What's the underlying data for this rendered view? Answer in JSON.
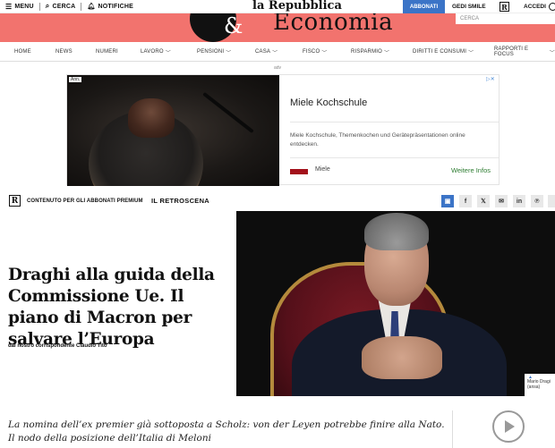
{
  "topbar": {
    "menu_label": "MENU",
    "search_label": "CERCA",
    "notifications_label": "NOTIFICHE",
    "logo": "la Repubblica",
    "subscribe_label": "ABBONATI",
    "gedi_label": "GEDI SMILE",
    "r_mark": "R",
    "login_label": "ACCEDI"
  },
  "banner": {
    "amp": "&",
    "title": "Economia",
    "search_placeholder": "CERCA"
  },
  "nav": {
    "items": [
      {
        "label": "HOME",
        "dropdown": false
      },
      {
        "label": "NEWS",
        "dropdown": false
      },
      {
        "label": "NUMERI",
        "dropdown": false
      },
      {
        "label": "LAVORO",
        "dropdown": true
      },
      {
        "label": "PENSIONI",
        "dropdown": true
      },
      {
        "label": "CASA",
        "dropdown": true
      },
      {
        "label": "FISCO",
        "dropdown": true
      },
      {
        "label": "RISPARMIO",
        "dropdown": true
      },
      {
        "label": "DIRITTI E CONSUMI",
        "dropdown": true
      },
      {
        "label": "RAPPORTI E FOCUS",
        "dropdown": true
      }
    ]
  },
  "ad": {
    "adv_label": "adv",
    "badge": "Ann.",
    "title": "Miele Kochschule",
    "description": "Miele Kochschule, Themenkochen und Gerätepräsentationen online entdecken.",
    "brand": "Miele",
    "cta": "Weitere Infos"
  },
  "section": {
    "r_mark": "R",
    "premium_label": "CONTENUTO PER GLI ABBONATI PREMIUM",
    "category": "IL RETROSCENA"
  },
  "share": {
    "icons": [
      "comment-icon",
      "facebook-icon",
      "x-icon",
      "mail-icon",
      "linkedin-icon",
      "pinterest-icon",
      "whatsapp-icon"
    ],
    "glyphs": [
      "▣",
      "f",
      "𝕏",
      "✉",
      "in",
      "℗",
      "◔"
    ]
  },
  "article": {
    "headline": "Draghi alla guida della Commissione Ue. Il piano di Macron per salvare l’Europa",
    "byline": "dal nostro corrispondente Claudio Tito",
    "photo_caption": "Mario Dragi (ansa)",
    "summary": "La nomina dell’ex premier già sottoposta a Scholz: von der Leyen potrebbe finire alla Nato. Il nodo della posizione dell’Italia di Meloni"
  },
  "colors": {
    "banner": "#f2736e",
    "accent_blue": "#3b74c7"
  }
}
